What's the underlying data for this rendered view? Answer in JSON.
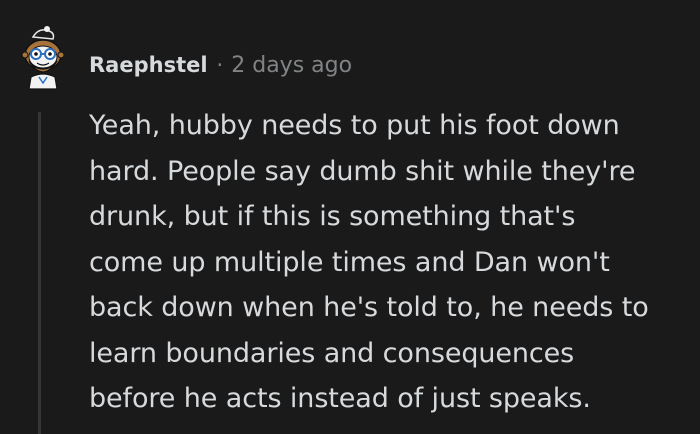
{
  "comment": {
    "author": "Raephstel",
    "separator": "·",
    "timestamp": "2 days ago",
    "avatar_icon": "snoo-avatar-icon",
    "body_lines": [
      "Yeah, hubby needs to put his foot down",
      "hard. People say dumb shit while they're",
      "drunk, but if this is something that's",
      "come up multiple times and Dan won't",
      "back down when he's told to, he needs to",
      "learn boundaries and consequences",
      "before he acts instead of just speaks."
    ]
  },
  "colors": {
    "background": "#1a1a1b",
    "text": "#d7dadc",
    "muted": "#818384",
    "thread_line": "#343536"
  }
}
